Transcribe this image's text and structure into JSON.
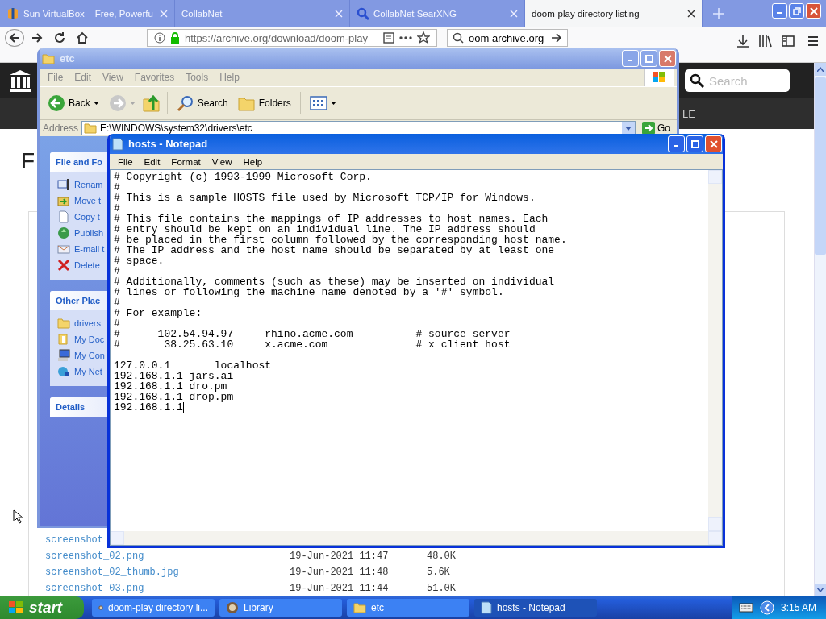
{
  "browser": {
    "tabs": [
      {
        "title": "Sun VirtualBox – Free, Powerfu",
        "kind": "box",
        "selected": false
      },
      {
        "title": "CollabNet",
        "kind": "page",
        "selected": false
      },
      {
        "title": "CollabNet SearXNG",
        "kind": "search",
        "selected": false
      },
      {
        "title": "doom-play directory listing",
        "kind": "page",
        "selected": true
      }
    ],
    "url": "https://archive.org/download/doom-play",
    "search_value": "oom archive.org",
    "site": {
      "search_placeholder": "Search",
      "nav_item": "LE",
      "heading": "F",
      "files": [
        {
          "name": "screenshot"
        },
        {
          "name": "screenshot_02.png",
          "date": "19-Jun-2021 11:47",
          "size": "48.0K"
        },
        {
          "name": "screenshot_02_thumb.jpg",
          "date": "19-Jun-2021 11:48",
          "size": "5.6K"
        },
        {
          "name": "screenshot_03.png",
          "date": "19-Jun-2021 11:44",
          "size": "51.0K"
        }
      ]
    }
  },
  "explorer": {
    "title": "etc",
    "menu": [
      "File",
      "Edit",
      "View",
      "Favorites",
      "Tools",
      "Help"
    ],
    "toolbar": {
      "back": "Back",
      "search": "Search",
      "folders": "Folders"
    },
    "address_label": "Address",
    "address": "E:\\WINDOWS\\system32\\drivers\\etc",
    "go": "Go",
    "panels": [
      {
        "title": "File and Fo",
        "items": [
          {
            "label": "Renam",
            "kind": "rename"
          },
          {
            "label": "Move t",
            "kind": "move"
          },
          {
            "label": "Copy t",
            "kind": "copy"
          },
          {
            "label": "Publish",
            "kind": "publish"
          },
          {
            "label": "E-mail t",
            "kind": "email"
          },
          {
            "label": "Delete",
            "kind": "delete"
          }
        ]
      },
      {
        "title": "Other Plac",
        "items": [
          {
            "label": "drivers",
            "kind": "folder"
          },
          {
            "label": "My Doc",
            "kind": "documents"
          },
          {
            "label": "My Con",
            "kind": "computer"
          },
          {
            "label": "My Net",
            "kind": "network"
          }
        ]
      },
      {
        "title": "Details"
      }
    ]
  },
  "notepad": {
    "title": "hosts - Notepad",
    "menu": [
      "File",
      "Edit",
      "Format",
      "View",
      "Help"
    ],
    "text": "# Copyright (c) 1993-1999 Microsoft Corp.\n#\n# This is a sample HOSTS file used by Microsoft TCP/IP for Windows.\n#\n# This file contains the mappings of IP addresses to host names. Each\n# entry should be kept on an individual line. The IP address should\n# be placed in the first column followed by the corresponding host name.\n# The IP address and the host name should be separated by at least one\n# space.\n#\n# Additionally, comments (such as these) may be inserted on individual\n# lines or following the machine name denoted by a '#' symbol.\n#\n# For example:\n#\n#      102.54.94.97     rhino.acme.com          # source server\n#       38.25.63.10     x.acme.com              # x client host\n\n127.0.0.1       localhost\n192.168.1.1 jars.ai\n192.168.1.1 dro.pm\n192.168.1.1 drop.pm\n192.168.1.1"
  },
  "taskbar": {
    "start": "start",
    "tasks": [
      {
        "label": "doom-play directory li...",
        "kind": "browser",
        "selected": false
      },
      {
        "label": "Library",
        "kind": "browser",
        "selected": false
      },
      {
        "label": "etc",
        "kind": "folder",
        "selected": false
      },
      {
        "label": "hosts - Notepad",
        "kind": "notepad",
        "selected": true
      }
    ],
    "clock": "3:15 AM"
  }
}
